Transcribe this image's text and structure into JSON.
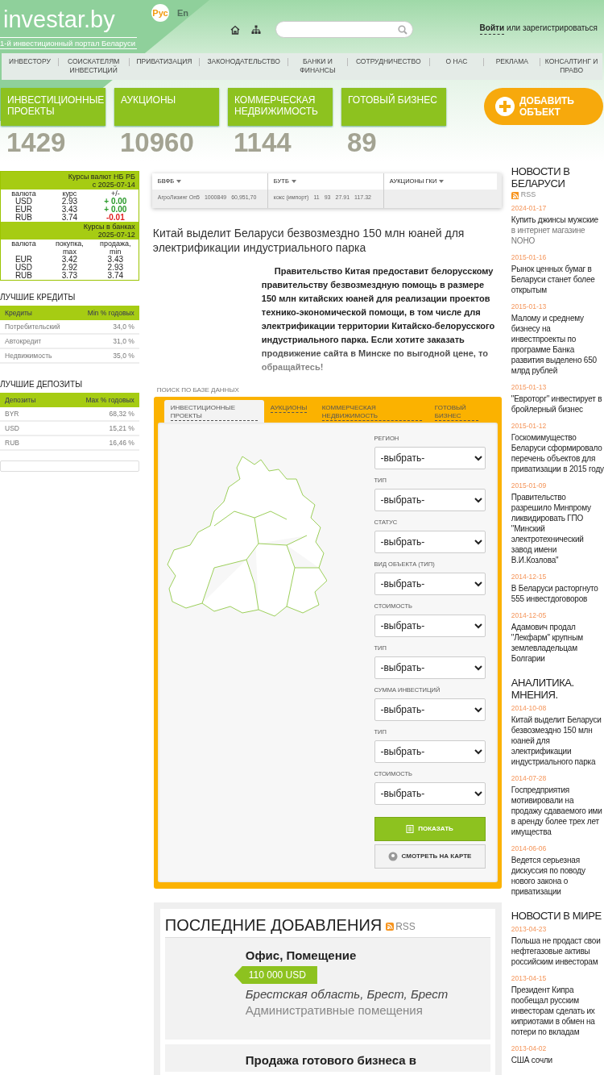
{
  "header": {
    "logo": "investar.by",
    "tagline": "1-й инвестиционный портал Беларуси",
    "languages": [
      {
        "label": "Рус",
        "selected": true
      },
      {
        "label": "En",
        "selected": false
      }
    ],
    "login_link": "Войти",
    "login_rest": "или зарегистрироваться"
  },
  "nav": [
    "ИНВЕСТОРУ",
    "СОИСКАТЕЛЯМ ИНВЕСТИЦИЙ",
    "ПРИВАТИЗАЦИЯ",
    "ЗАКОНОДАТЕЛЬСТВО",
    "БАНКИ И ФИНАНСЫ",
    "СОТРУДНИЧЕСТВО",
    "О НАС",
    "РЕКЛАМА",
    "КОНСАЛТИНГ И ПРАВО"
  ],
  "categories": [
    {
      "label": "ИНВЕСТИЦИОННЫЕ ПРОЕКТЫ",
      "count": "1429"
    },
    {
      "label": "АУКЦИОНЫ",
      "count": "10960"
    },
    {
      "label": "КОММЕРЧЕСКАЯ НЕДВИЖИМОСТЬ",
      "count": "1144"
    },
    {
      "label": "ГОТОВЫЙ БИЗНЕС",
      "count": "89"
    }
  ],
  "add_button": "ДОБАВИТЬ ОБЪЕКТ",
  "nb_rates": {
    "title": "Курсы валют НБ РБ",
    "date": "с   2025-07-14",
    "columns": [
      "валюта",
      "курс",
      "+/-"
    ],
    "rows": [
      {
        "currency": "USD",
        "rate": "2.93",
        "change": "+ 0.00",
        "color": "#2a9a2a"
      },
      {
        "currency": "EUR",
        "rate": "3.43",
        "change": "+ 0.00",
        "color": "#2a9a2a"
      },
      {
        "currency": "RUB",
        "rate": "3.74",
        "change": "-0.01",
        "color": "#e02020"
      }
    ]
  },
  "bank_rates": {
    "title": "Курсы в банках",
    "date": "2025-07-12",
    "columns": [
      "валюта",
      "покупка, max",
      "продажа, min"
    ],
    "rows": [
      [
        "EUR",
        "3.42",
        "3.43"
      ],
      [
        "USD",
        "2.92",
        "2.93"
      ],
      [
        "RUB",
        "3.73",
        "3.74"
      ]
    ]
  },
  "credits": {
    "title": "ЛУЧШИЕ КРЕДИТЫ",
    "columns": [
      "Кредиты",
      "Min % годовых"
    ],
    "rows": [
      [
        "Потребительский",
        "34,0 %"
      ],
      [
        "Автокредит",
        "31,0 %"
      ],
      [
        "Недвижимость",
        "35,0 %"
      ]
    ]
  },
  "deposits": {
    "title": "ЛУЧШИЕ ДЕПОЗИТЫ",
    "columns": [
      "Депозиты",
      "Max % годовых"
    ],
    "rows": [
      [
        "BYR",
        "68,32 %"
      ],
      [
        "USD",
        "15,21 %"
      ],
      [
        "RUB",
        "16,46 %"
      ]
    ]
  },
  "ticker": [
    {
      "title": "БВФБ",
      "values": [
        "АгроЛизинг Оп5",
        "1000849",
        "60,951,70"
      ]
    },
    {
      "title": "БУТБ",
      "values": [
        "кокс (импорт)",
        "11",
        "93",
        "27.91",
        "117.32"
      ]
    },
    {
      "title": "АУКЦИОНЫ ГКИ"
    }
  ],
  "article": {
    "title": "Китай выделит Беларуси безвозмездно 150 млн юаней для электрификации индустриального парка",
    "body": "Правительство Китая предоставит белорусскому правительству безвозмездную помощь в размере 150 млн китайских юаней для реализации проектов технико-экономической помощи, в том числе для электрификации территории Китайско-белорусского индустриального парка. Если хотите заказать продвижение сайта в Минске по выгодной цене, то обращайтесь!"
  },
  "search": {
    "caption": "ПОИСК ПО БАЗЕ ДАННЫХ",
    "tabs": [
      {
        "label": "ИНВЕСТИЦИОННЫЕ ПРОЕКТЫ",
        "selected": true
      },
      {
        "label": "АУКЦИОНЫ",
        "selected": false
      },
      {
        "label": "КОММЕРЧЕСКАЯ НЕДВИЖИМОСТЬ",
        "selected": false
      },
      {
        "label": "ГОТОВЫЙ БИЗНЕС",
        "selected": false
      }
    ],
    "fields": [
      {
        "label": "РЕГИОН",
        "value": "-выбрать-"
      },
      {
        "label": "ТИП",
        "value": "-выбрать-"
      },
      {
        "label": "СТАТУС",
        "value": "-выбрать-"
      },
      {
        "label": "ВИД ОБЪЕКТА (ТИП)",
        "value": "-выбрать-"
      },
      {
        "label": "СТОИМОСТЬ",
        "value": "-выбрать-"
      },
      {
        "label": "ТИП",
        "value": "-выбрать-"
      },
      {
        "label": "СУММА ИНВЕСТИЦИЙ",
        "value": "-выбрать-"
      },
      {
        "label": "ТИП",
        "value": "-выбрать-"
      },
      {
        "label": "СТОИМОСТЬ",
        "value": "-выбрать-"
      }
    ],
    "show_button": "ПОКАЗАТЬ",
    "map_button": "СМОТРЕТЬ НА КАРТЕ"
  },
  "latest": {
    "title": "ПОСЛЕДНИЕ ДОБАВЛЕНИЯ",
    "rss": "RSS",
    "items": [
      {
        "title": "Офис, Помещение",
        "price": "110 000 USD",
        "location": "Брестская область, Брест, Брест",
        "category": "Административные помещения"
      },
      {
        "title": "Продажа готового бизнеса в"
      }
    ]
  },
  "news_sections": [
    {
      "title": "НОВОСТИ В БЕЛАРУСИ",
      "rss": "RSS",
      "items": [
        {
          "date": "2024-01-17",
          "text": "Купить джинсы мужские",
          "extra": "в интернет магазине NOHO"
        },
        {
          "date": "2015-01-16",
          "text": "Рынок ценных бумаг в Беларуси станет более открытым"
        },
        {
          "date": "2015-01-13",
          "text": "Малому и среднему бизнесу на инвестпроекты по программе Банка развития выделено 650 млрд рублей"
        },
        {
          "date": "2015-01-13",
          "text": "\"Евроторг\" инвестирует в бройлерный бизнес"
        },
        {
          "date": "2015-01-12",
          "text": "Госкомимущество Беларуси сформировало перечень объектов для приватизации в 2015 году"
        },
        {
          "date": "2015-01-09",
          "text": "Правительство разрешило Минпрому ликвидировать ГПО \"Минский электротехнический завод имени В.И.Козлова\""
        },
        {
          "date": "2014-12-15",
          "text": "В Беларуси расторгнуто 555 инвестдоговоров"
        },
        {
          "date": "2014-12-05",
          "text": "Адамович продал \"Лекфарм\" крупным землевладельцам Болгарии"
        }
      ]
    },
    {
      "title": "АНАЛИТИКА. МНЕНИЯ.",
      "items": [
        {
          "date": "2014-10-08",
          "text": "Китай выделит Беларуси безвозмездно 150 млн юаней для электрификации индустриального парка"
        },
        {
          "date": "2014-07-28",
          "text": "Госпредприятия мотивировали на продажу сдаваемого ими в аренду более трех лет имущества"
        },
        {
          "date": "2014-06-06",
          "text": "Ведется серьезная дискуссия по поводу нового закона о приватизации"
        }
      ]
    },
    {
      "title": "НОВОСТИ В МИРЕ",
      "items": [
        {
          "date": "2013-04-23",
          "text": "Польша не продаст свои нефтегазовые активы российским инвесторам"
        },
        {
          "date": "2013-04-15",
          "text": "Президент Кипра пообещал русским инвесторам сделать их киприотами в обмен на потери по вкладам"
        },
        {
          "date": "2013-04-02",
          "text": "США сочли"
        }
      ]
    }
  ]
}
